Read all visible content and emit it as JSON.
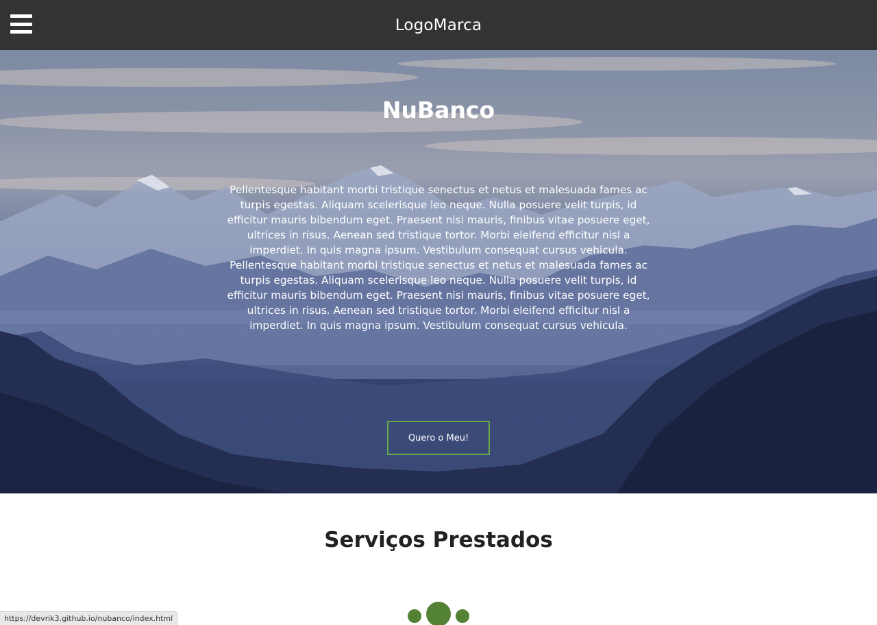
{
  "header": {
    "menu_icon": "hamburger-menu-icon",
    "logo": "LogoMarca",
    "background": "#333333"
  },
  "hero": {
    "title": "NuBanco",
    "text": "Pellentesque habitant morbi tristique senectus et netus et malesuada fames ac turpis egestas. Aliquam scelerisque leo neque. Nulla posuere velit turpis, id efficitur mauris bibendum eget. Praesent nisi mauris, finibus vitae posuere eget, ultrices in risus. Aenean sed tristique tortor. Morbi eleifend efficitur nisl a imperdiet. In quis magna ipsum. Vestibulum consequat cursus vehicula. Pellentesque habitant morbi tristique senectus et netus et malesuada fames ac turpis egestas. Aliquam scelerisque leo neque. Nulla posuere velit turpis, id efficitur mauris bibendum eget. Praesent nisi mauris, finibus vitae posuere eget, ultrices in risus. Aenean sed tristique tortor. Morbi eleifend efficitur nisl a imperdiet. In quis magna ipsum. Vestibulum consequat cursus vehicula.",
    "button_label": "Quero o Meu!",
    "button_border_color": "#6aa84f"
  },
  "services": {
    "title": "Serviços Prestados",
    "accent_color": "#548235"
  },
  "status_bar": {
    "url": "https://devrik3.github.io/nubanco/index.html"
  }
}
